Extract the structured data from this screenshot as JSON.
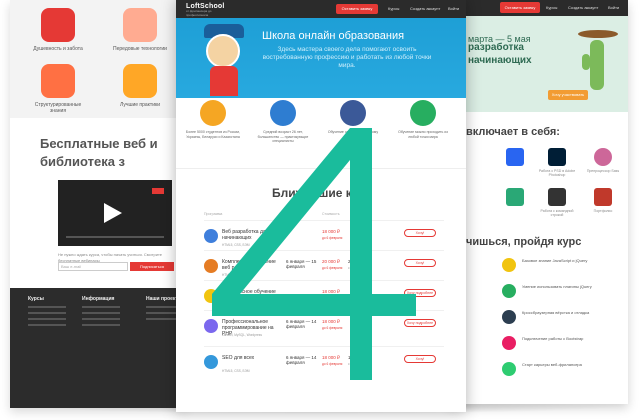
{
  "overlay": {
    "big_number": "4",
    "color": "#1abc9c"
  },
  "center_page": {
    "logo_text": "LoftSchool",
    "logo_sub": "от фрилансера до профессионала",
    "nav": {
      "cta": "Оставить заявку",
      "courses": "Курсы",
      "signup": "Создать аккаунт",
      "login": "Войти"
    },
    "hero": {
      "title": "Школа онлайн образования",
      "subtitle": "Здесь мастера своего дела помогают освоить востребованную профессию и работать из любой точки мира."
    },
    "features": [
      {
        "icon": "students-icon",
        "color": "#f5a623",
        "text": "Более 5000 студентов из России, Украины, Беларуси и Казахстана"
      },
      {
        "icon": "graduate-icon",
        "color": "#2e7dd1",
        "text": "Средний возраст 26 лет, большинство — практикующие специалисты"
      },
      {
        "icon": "paper-plane-icon",
        "color": "#3b5998",
        "text": "Обучение онлайн по удобному графику"
      },
      {
        "icon": "globe-icon",
        "color": "#27ae60",
        "text": "Обучение можно проходить из любой точки мира"
      }
    ],
    "section_title": "Ближайшие к",
    "table_headers": {
      "course": "Программа",
      "date": "Даты",
      "price": "Стоимость"
    },
    "courses": [
      {
        "avatar": "#3f7fdc",
        "name": "Веб разработка для начинающих",
        "skills": "HTML5, CSS, БЭМ",
        "date": "",
        "price": "18 000 ₽",
        "price_note": "до 6 февраля",
        "price_base": "",
        "price_base_note": "",
        "button": "Хочу!"
      },
      {
        "avatar": "#e57c24",
        "name": "Комплексное обучение веб разработке",
        "skills": "HTML5, CSS, БЭМ, JS",
        "date": "6 января — 15 февраля",
        "price": "20 000 ₽",
        "price_note": "до 6 февраля",
        "price_base": "22 000 ₽",
        "price_base_note": "с 14 марта",
        "button": "Хочу!"
      },
      {
        "avatar": "#f1c40f",
        "name": "Комплексное обучение JavaScript",
        "skills": "JS, jQuery, Node.js",
        "date": "",
        "price": "18 000 ₽",
        "price_note": "до 6 февраля",
        "price_base": "",
        "price_base_note": "",
        "button": "Хочу подробнее"
      },
      {
        "avatar": "#7b68ee",
        "name": "Профессиональное программирование на PHP",
        "skills": "Laravel, MySQL, Wordpress",
        "date": "6 января — 14 февраля",
        "price": "18 000 ₽",
        "price_note": "до 6 февраля",
        "price_base": "",
        "price_base_note": "",
        "button": "Хочу подробнее"
      },
      {
        "avatar": "#3498db",
        "name": "SEO для всех",
        "skills": "HTML5, CSS, БЭМ",
        "date": "6 января — 14 февраля",
        "price": "18 000 ₽",
        "price_note": "до 6 февраля",
        "price_base": "17 000 ₽",
        "price_base_note": "с 14 марта",
        "button": "Хочу!"
      }
    ]
  },
  "left_page": {
    "features": [
      {
        "icon": "heart-icon",
        "color": "#e53935",
        "text": "Душевность и забота"
      },
      {
        "icon": "rocket-icon",
        "color": "#ff8a65",
        "text": "Передовые технологии"
      },
      {
        "icon": "puzzle-icon",
        "color": "#ff7043",
        "text": "Структурированные знания"
      },
      {
        "icon": "star-icon",
        "color": "#ffa726",
        "text": "Лучшие практики"
      }
    ],
    "title": "Бесплатные веб и библиотека з",
    "video_caption": "Не нужно ждать курса, чтобы начать учиться. Смотрите бесплатные вебинары",
    "email_placeholder": "Ваш e-mail",
    "subscribe_button": "Подписаться",
    "footer": {
      "col1_title": "Курсы",
      "col2_title": "Информация",
      "col3_title": "Наши проекты"
    }
  },
  "right_page": {
    "nav": {
      "cta": "Оставить заявку",
      "courses": "Курсы",
      "signup": "Создать аккаунт",
      "login": "Войти"
    },
    "hero_date": "марта — 5 мая",
    "hero_title": "разработка начинающих",
    "hero_button": "Хочу участвовать",
    "includes_title": "включает в себя:",
    "tools": [
      {
        "icon": "css3-icon",
        "color": "#2965f1",
        "label": ""
      },
      {
        "icon": "photoshop-icon",
        "color": "#001e36",
        "label": "Работа с PSD в Adobe Photoshop"
      },
      {
        "icon": "sass-icon",
        "color": "#cd6799",
        "label": "Препроцессор Sass"
      },
      {
        "icon": "webstorm-icon",
        "color": "#2aa876",
        "label": ""
      },
      {
        "icon": "terminal-icon",
        "color": "#333333",
        "label": "Работа с командной строкой"
      },
      {
        "icon": "portfolio-icon",
        "color": "#c0392b",
        "label": "Портфолио"
      }
    ],
    "learn_title": "чишься, пройдя курс",
    "outcomes": [
      {
        "color": "#f1c40f",
        "text": "Базовое знание JavaScript и jQuery"
      },
      {
        "color": "#27ae60",
        "text": "Умение использовать плагины jQuery"
      },
      {
        "color": "#2c3e50",
        "text": "Кроссбраузерная вёрстка и отладка"
      },
      {
        "color": "#e91e63",
        "text": "Подключение работы с Bootstrap"
      },
      {
        "color": "#2ecc71",
        "text": "Старт карьеры веб-фрилансера"
      }
    ]
  }
}
